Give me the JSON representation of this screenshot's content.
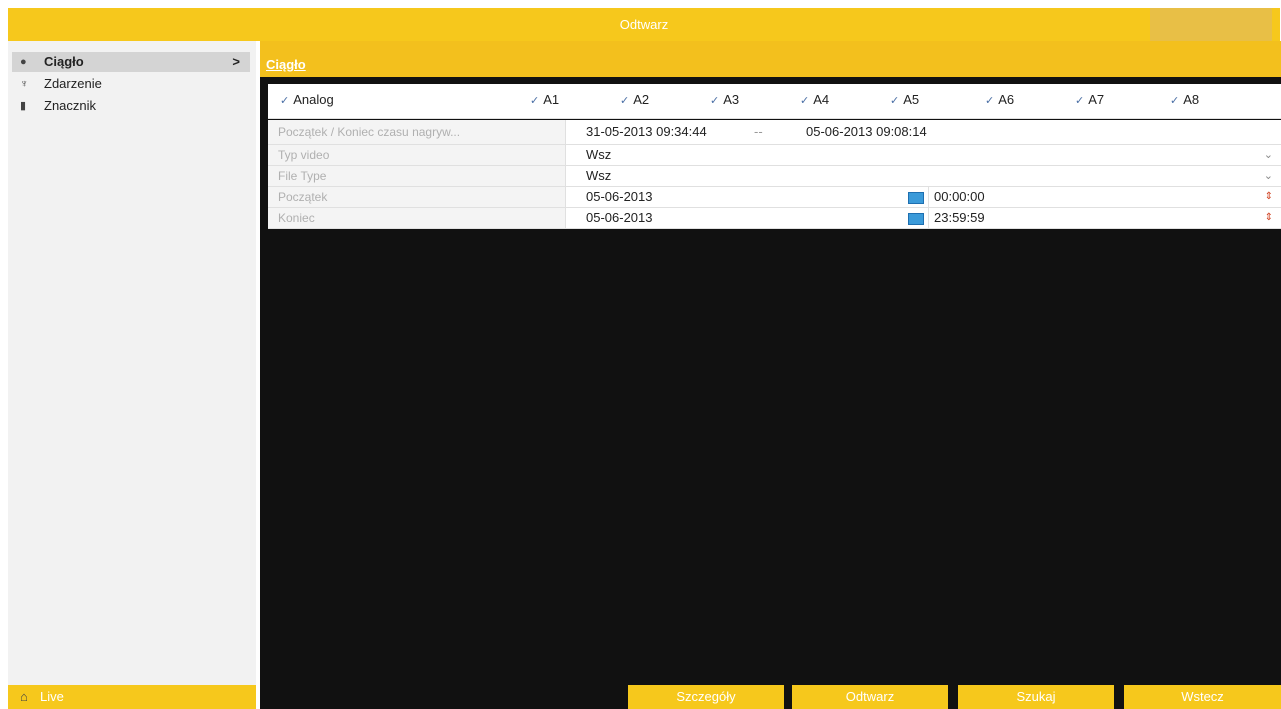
{
  "window": {
    "title": "Odtwarz"
  },
  "sidebar": {
    "items": [
      {
        "label": "Ciągło",
        "icon": "circle-icon",
        "active": true,
        "chevron": ">"
      },
      {
        "label": "Zdarzenie",
        "icon": "trophy-icon",
        "active": false
      },
      {
        "label": "Znacznik",
        "icon": "bookmark-icon",
        "active": false
      }
    ],
    "live_label": "Live",
    "live_icon": "home-icon"
  },
  "main": {
    "section_title": "Ciągło",
    "channels": {
      "analog_label": "Analog",
      "items": [
        "A1",
        "A2",
        "A3",
        "A4",
        "A5",
        "A6",
        "A7",
        "A8"
      ]
    },
    "record_range": {
      "label": "Początek / Koniec czasu nagryw...",
      "start": "31-05-2013 09:34:44",
      "dash": "--",
      "end": "05-06-2013 09:08:14"
    },
    "video_type": {
      "label": "Typ video",
      "value": "Wsz"
    },
    "file_type": {
      "label": "File Type",
      "value": "Wsz"
    },
    "start": {
      "label": "Początek",
      "date": "05-06-2013",
      "time": "00:00:00"
    },
    "end": {
      "label": "Koniec",
      "date": "05-06-2013",
      "time": "23:59:59"
    }
  },
  "buttons": {
    "details": "Szczegóły",
    "play": "Odtwarz",
    "search": "Szukaj",
    "back": "Wstecz"
  },
  "colors": {
    "accent": "#f6c81c",
    "background": "#111111"
  }
}
